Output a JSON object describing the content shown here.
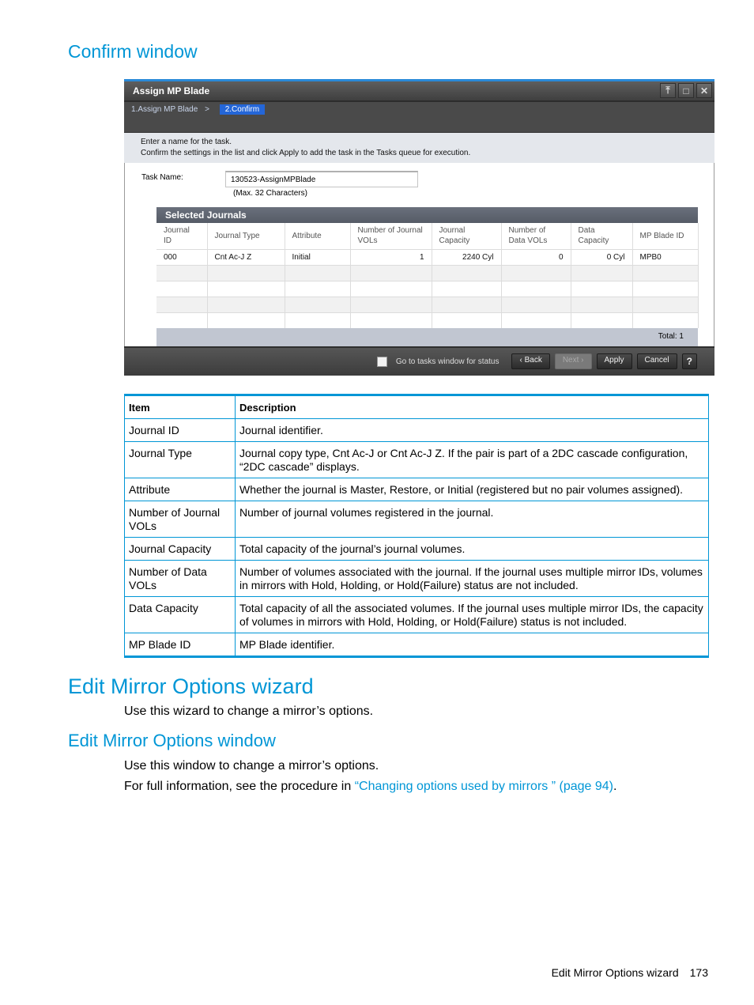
{
  "headings": {
    "confirm_window": "Confirm window",
    "edit_mirror_wizard": "Edit Mirror Options wizard",
    "edit_mirror_window": "Edit Mirror Options window"
  },
  "dialog": {
    "title": "Assign MP Blade",
    "window_buttons": [
      "restore-icon",
      "maximize-icon",
      "close-icon"
    ],
    "breadcrumb": {
      "step1": "1.Assign MP Blade",
      "separator": ">",
      "step2": "2.Confirm"
    },
    "instructions": [
      "Enter a name for the task.",
      "Confirm the settings in the list and click Apply to add the task in the Tasks queue for execution."
    ],
    "task_name_label": "Task Name:",
    "task_name_value": "130523-AssignMPBlade",
    "task_name_hint": "(Max. 32 Characters)",
    "selected_journals": {
      "title": "Selected Journals",
      "columns": [
        "Journal ID",
        "Journal Type",
        "Attribute",
        "Number of Journal VOLs",
        "Journal Capacity",
        "Number of Data VOLs",
        "Data Capacity",
        "MP Blade ID"
      ],
      "rows": [
        [
          "000",
          "Cnt Ac-J Z",
          "Initial",
          "1",
          "2240 Cyl",
          "0",
          "0 Cyl",
          "MPB0"
        ]
      ],
      "total": "Total:  1"
    },
    "footer": {
      "checkbox_label": "Go to tasks window for status",
      "back": "Back",
      "next": "Next",
      "apply": "Apply",
      "cancel": "Cancel",
      "help": "?"
    }
  },
  "desc_table": {
    "headers": [
      "Item",
      "Description"
    ],
    "rows": [
      [
        "Journal ID",
        "Journal identifier."
      ],
      [
        "Journal Type",
        "Journal copy type, Cnt Ac-J or Cnt Ac-J Z. If the pair is part of a 2DC cascade configuration, “2DC cascade” displays."
      ],
      [
        "Attribute",
        "Whether the journal is Master, Restore, or Initial (registered but no pair volumes assigned)."
      ],
      [
        "Number of Journal VOLs",
        "Number of journal volumes registered in the journal."
      ],
      [
        "Journal Capacity",
        "Total capacity of the journal’s journal volumes."
      ],
      [
        "Number of Data VOLs",
        "Number of volumes associated with the journal. If the journal uses multiple mirror IDs, volumes in mirrors with Hold, Holding, or Hold(Failure) status are not included."
      ],
      [
        "Data Capacity",
        "Total capacity of all the associated volumes. If the journal uses multiple mirror IDs, the capacity of volumes in mirrors with Hold, Holding, or Hold(Failure) status is not included."
      ],
      [
        "MP Blade ID",
        "MP Blade identifier."
      ]
    ]
  },
  "paragraphs": {
    "wizard_intro": "Use this wizard to change a mirror’s options.",
    "window_intro": "Use this window to change a mirror’s options.",
    "full_info_prefix": "For full information, see the procedure in ",
    "full_info_link": "“Changing options used by mirrors ” (page 94)",
    "full_info_suffix": "."
  },
  "footer": {
    "section": "Edit Mirror Options wizard",
    "page_number": "173"
  }
}
